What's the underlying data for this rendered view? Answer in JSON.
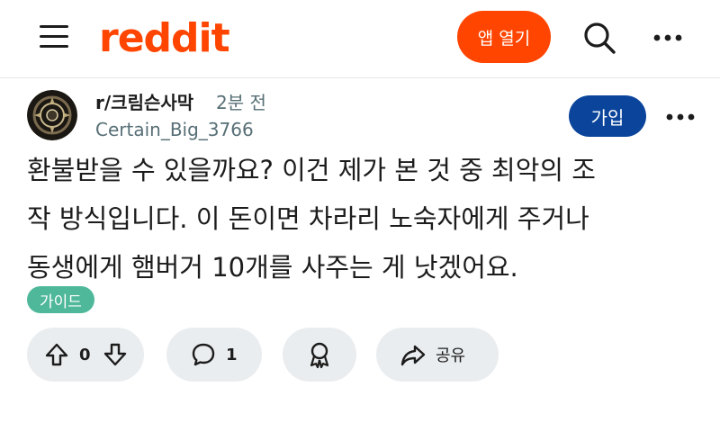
{
  "header": {
    "logo_text": "reddit",
    "open_app_label": "앱 열기",
    "menu_icon": "hamburger-menu-icon",
    "search_icon": "search-icon",
    "more_icon": "more-horizontal-icon",
    "brand_color": "#ff4500"
  },
  "post": {
    "subreddit": "r/크림슨사막",
    "time_ago": "2분 전",
    "username": "Certain_Big_3766",
    "join_label": "가입",
    "join_color": "#0a449b",
    "body_lines": [
      "환불받을 수 있을까요? 이건 제가 본 것 중 최악의 조",
      "작 방식입니다. 이 돈이면 차라리 노숙자에게 주거나",
      "동생에게 햄버거 10개를 사주는 게 낫겠어요."
    ],
    "flair": "가이드",
    "flair_color": "#4fb89a"
  },
  "actions": {
    "vote_count": "0",
    "comment_count": "1",
    "share_label": "공유"
  }
}
